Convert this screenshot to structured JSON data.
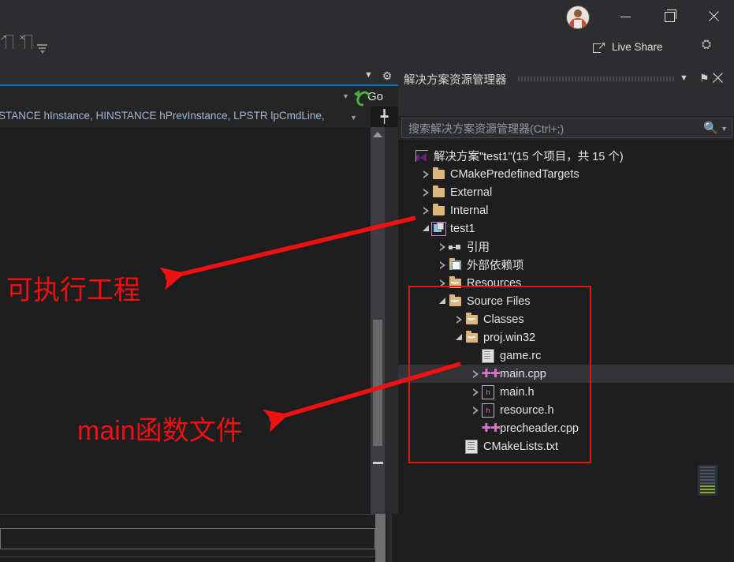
{
  "titlebar": {
    "avatar_name": "user-avatar",
    "minimize_label": "—",
    "maximize_label": "❐",
    "close_label": "✕",
    "live_share_label": "Live Share",
    "share_person_label": "⛭"
  },
  "editor": {
    "navigate_go_label": "Go",
    "signature_text": "STANCE hInstance, HINSTANCE hPrevInstance, LPSTR lpCmdLine,",
    "dropdown_glyph": "▼",
    "gear_glyph": "⚙",
    "split_glyph": "╇"
  },
  "solution_explorer": {
    "title": "解决方案资源管理器",
    "chevron_glyph": "▼",
    "pin_glyph": "⚑",
    "search_placeholder": "搜索解决方案资源管理器(Ctrl+;)",
    "search_icon_glyph": "⌕",
    "search_dropdown_glyph": "▼",
    "toolbar": [
      {
        "name": "back",
        "glyph": "←"
      },
      {
        "name": "forward",
        "glyph": "→"
      },
      {
        "name": "home",
        "glyph": "⌂"
      },
      {
        "name": "pending-changes",
        "glyph": ""
      },
      {
        "name": "history",
        "glyph": "◴"
      },
      {
        "name": "history-dropdown",
        "glyph": "▼"
      },
      {
        "name": "refresh",
        "glyph": "↻"
      },
      {
        "name": "collapse-all",
        "glyph": "❐"
      },
      {
        "name": "show-all-files",
        "glyph": "❐"
      },
      {
        "name": "code-view",
        "glyph": "<>"
      },
      {
        "name": "properties-wrench",
        "glyph": "ὒ7"
      },
      {
        "name": "preview-selected",
        "glyph": "▬"
      }
    ],
    "tree": [
      {
        "label": "解决方案\"test1\"(15 个项目，共 15 个)",
        "indent": 0,
        "twisty": "none",
        "icon": "vs-solution",
        "selected": false
      },
      {
        "label": "CMakePredefinedTargets",
        "indent": 1,
        "twisty": "closed",
        "icon": "folder",
        "selected": false
      },
      {
        "label": "External",
        "indent": 1,
        "twisty": "closed",
        "icon": "folder",
        "selected": false
      },
      {
        "label": "Internal",
        "indent": 1,
        "twisty": "closed",
        "icon": "folder",
        "selected": false
      },
      {
        "label": "test1",
        "indent": 1,
        "twisty": "open",
        "icon": "project",
        "selected": false
      },
      {
        "label": "引用",
        "indent": 2,
        "twisty": "closed",
        "icon": "references",
        "selected": false
      },
      {
        "label": "外部依赖项",
        "indent": 2,
        "twisty": "closed",
        "icon": "ext-dependencies",
        "selected": false
      },
      {
        "label": "Resources",
        "indent": 2,
        "twisty": "closed",
        "icon": "filter-folder",
        "selected": false
      },
      {
        "label": "Source Files",
        "indent": 2,
        "twisty": "open",
        "icon": "filter-folder",
        "selected": false
      },
      {
        "label": "Classes",
        "indent": 3,
        "twisty": "closed",
        "icon": "filter-folder",
        "selected": false
      },
      {
        "label": "proj.win32",
        "indent": 3,
        "twisty": "open",
        "icon": "filter-folder",
        "selected": false
      },
      {
        "label": "game.rc",
        "indent": 4,
        "twisty": "none",
        "icon": "rc-file",
        "selected": false
      },
      {
        "label": "main.cpp",
        "indent": 4,
        "twisty": "closed",
        "icon": "cpp-file",
        "selected": true
      },
      {
        "label": "main.h",
        "indent": 4,
        "twisty": "closed",
        "icon": "h-file",
        "selected": false
      },
      {
        "label": "resource.h",
        "indent": 4,
        "twisty": "closed",
        "icon": "h-file",
        "selected": false
      },
      {
        "label": "precheader.cpp",
        "indent": 4,
        "twisty": "none",
        "icon": "cpp-file",
        "selected": false
      },
      {
        "label": "CMakeLists.txt",
        "indent": 3,
        "twisty": "none",
        "icon": "txt-file",
        "selected": false
      }
    ]
  },
  "annotations": {
    "color": "#ee1111",
    "label_executable_project": "可执行工程",
    "label_main_function_file": "main函数文件"
  }
}
